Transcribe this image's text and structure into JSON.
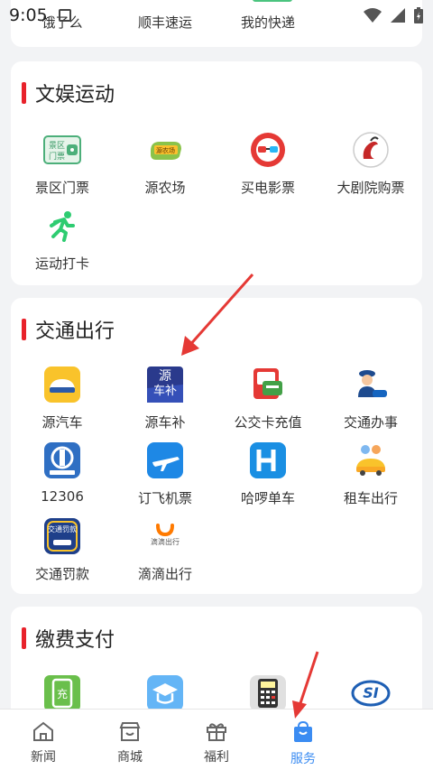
{
  "status_bar": {
    "time": "9:05"
  },
  "top_row": [
    "饿了么",
    "顺丰速运",
    "我的快递"
  ],
  "sections": {
    "entertainment": {
      "title": "文娱运动",
      "items": [
        {
          "label": "景区门票",
          "icon": "scenic-ticket-icon"
        },
        {
          "label": "源农场",
          "icon": "farm-icon"
        },
        {
          "label": "买电影票",
          "icon": "movie-ticket-icon"
        },
        {
          "label": "大剧院购票",
          "icon": "theater-icon"
        },
        {
          "label": "运动打卡",
          "icon": "running-icon"
        }
      ]
    },
    "traffic": {
      "title": "交通出行",
      "items": [
        {
          "label": "源汽车",
          "icon": "car-icon"
        },
        {
          "label": "源车补",
          "icon": "car-subsidy-icon",
          "icon_text_1": "源",
          "icon_text_2": "车补"
        },
        {
          "label": "公交卡充值",
          "icon": "bus-card-icon"
        },
        {
          "label": "交通办事",
          "icon": "traffic-police-icon"
        },
        {
          "label": "12306",
          "icon": "railway-icon"
        },
        {
          "label": "订飞机票",
          "icon": "airplane-icon"
        },
        {
          "label": "哈啰单车",
          "icon": "hello-bike-icon"
        },
        {
          "label": "租车出行",
          "icon": "car-rental-icon"
        },
        {
          "label": "交通罚款",
          "icon": "traffic-fine-icon",
          "icon_text": "交通罚款"
        },
        {
          "label": "滴滴出行",
          "icon": "didi-icon",
          "icon_text": "滴滴出行"
        }
      ]
    },
    "payment": {
      "title": "缴费支付",
      "items": [
        {
          "label": "",
          "icon": "phone-recharge-icon",
          "icon_text": "充"
        },
        {
          "label": "",
          "icon": "education-icon"
        },
        {
          "label": "",
          "icon": "calculator-icon"
        },
        {
          "label": "",
          "icon": "social-security-icon",
          "icon_text": "SI"
        }
      ]
    }
  },
  "tabbar": [
    {
      "label": "新闻",
      "icon": "news-icon"
    },
    {
      "label": "商城",
      "icon": "mall-icon"
    },
    {
      "label": "福利",
      "icon": "gift-icon"
    },
    {
      "label": "服务",
      "icon": "service-bag-icon",
      "active": true
    }
  ],
  "colors": {
    "accent_red": "#e8222b",
    "active_blue": "#3b8cf2",
    "arrow_red": "#e53935"
  }
}
